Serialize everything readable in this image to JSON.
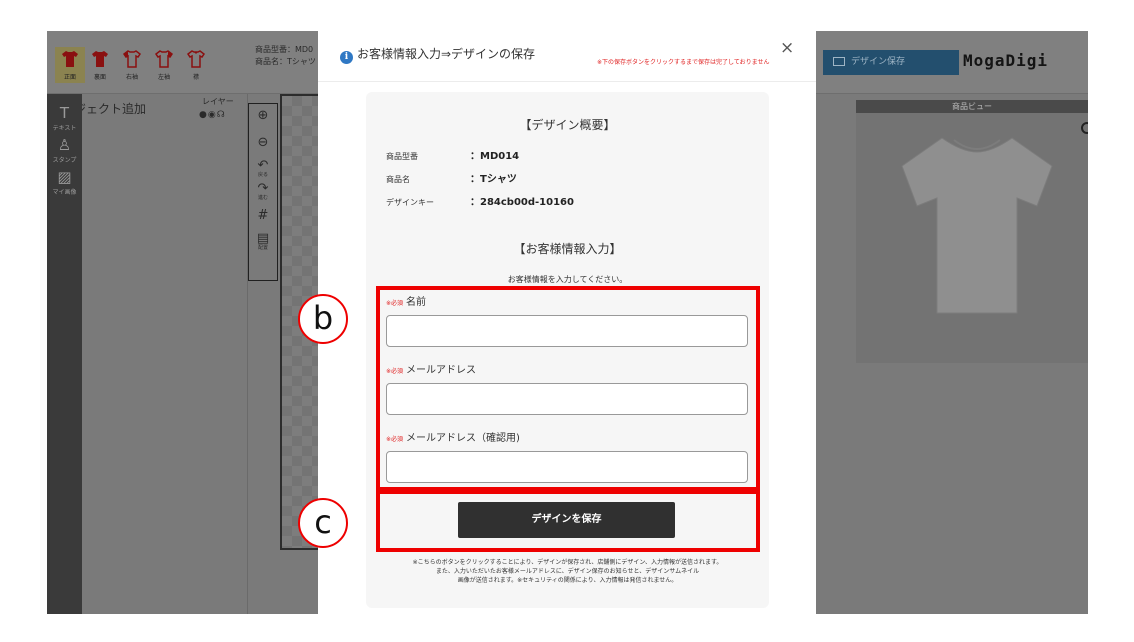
{
  "editor": {
    "views": [
      {
        "label": "正面",
        "active": true
      },
      {
        "label": "裏面",
        "active": false
      },
      {
        "label": "右袖",
        "active": false
      },
      {
        "label": "左袖",
        "active": false
      },
      {
        "label": "襟",
        "active": false
      }
    ],
    "product_info_line1": "商品型番：MD0",
    "product_info_line2": "商品名：Tシャツ",
    "save_top_label": "デザイン保存",
    "logo": "MogaDigi",
    "object_panel_title": "オブジェクト追加",
    "layer_label": "レイヤー",
    "left_tools": [
      {
        "glyph": "T",
        "label": "テキスト"
      },
      {
        "glyph": "♙",
        "label": "スタンプ"
      },
      {
        "glyph": "▨",
        "label": "マイ画像"
      }
    ],
    "zoom_tools": [
      {
        "glyph": "⊕",
        "label": ""
      },
      {
        "glyph": "⊖",
        "label": ""
      },
      {
        "glyph": "↶",
        "label": "戻る"
      },
      {
        "glyph": "↷",
        "label": "進む"
      },
      {
        "glyph": "#",
        "label": ""
      },
      {
        "glyph": "▤",
        "label": "配置"
      }
    ],
    "preview_title": "商品ビュー"
  },
  "modal": {
    "title": "お客様情報入力⇒デザインの保存",
    "note": "※下の保存ボタンをクリックするまで保存は完了しておりません",
    "close_symbol": "×",
    "summary_heading": "【デザイン概要】",
    "summary_rows": [
      {
        "label": "商品型番",
        "value": "：MD014"
      },
      {
        "label": "商品名",
        "value": "：Tシャツ"
      },
      {
        "label": "デザインキー",
        "value": "：284cb00d-10160"
      }
    ],
    "customer_heading": "【お客様情報入力】",
    "customer_sub": "お客様情報を入力してください。",
    "required_mark": "※必須",
    "fields": [
      {
        "label": "名前",
        "value": ""
      },
      {
        "label": "メールアドレス",
        "value": ""
      },
      {
        "label": "メールアドレス（確認用)",
        "value": ""
      }
    ],
    "save_button": "デザインを保存",
    "disclaimer_1": "※こちらのボタンをクリックすることにより、デザインが保存され、店舗側にデザイン、入力情報が送信されます。",
    "disclaimer_2": "また、入力いただいたお客様メールアドレスに、デザイン保存のお知らせと、デザインサムネイル",
    "disclaimer_3": "画像が送信されます。※セキュリティの関係により、入力情報は発信されません。"
  },
  "annotations": {
    "callout_b": "b",
    "callout_c": "c",
    "color": "#ee0000"
  }
}
